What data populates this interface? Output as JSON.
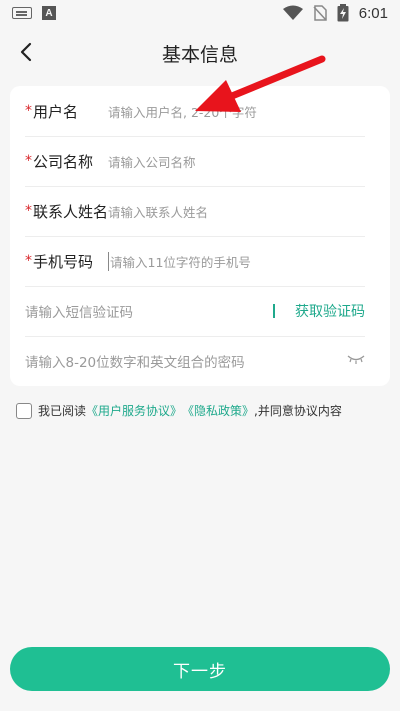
{
  "status_bar": {
    "time": "6:01",
    "a_label": "A"
  },
  "header": {
    "title": "基本信息"
  },
  "form": {
    "username": {
      "required_mark": "*",
      "label": "用户名",
      "placeholder": "请输入用户名, 2-20个字符"
    },
    "company": {
      "required_mark": "*",
      "label": "公司名称",
      "placeholder": "请输入公司名称"
    },
    "contact": {
      "required_mark": "*",
      "label": "联系人姓名",
      "placeholder": "请输入联系人姓名"
    },
    "phone": {
      "required_mark": "*",
      "label": "手机号码",
      "placeholder": "请输入11位字符的手机号"
    },
    "sms": {
      "placeholder": "请输入短信验证码",
      "get_code_label": "获取验证码"
    },
    "password": {
      "placeholder": "请输入8-20位数字和英文组合的密码"
    }
  },
  "agreement": {
    "prefix": "我已阅读",
    "user_agreement": "《用户服务协议》",
    "privacy_policy": "《隐私政策》",
    "suffix": ",并同意协议内容"
  },
  "footer": {
    "next_label": "下一步"
  },
  "colors": {
    "accent": "#1fbf93",
    "link": "#1fa98c",
    "required": "#d8262b",
    "annotation": "#e8141c"
  }
}
